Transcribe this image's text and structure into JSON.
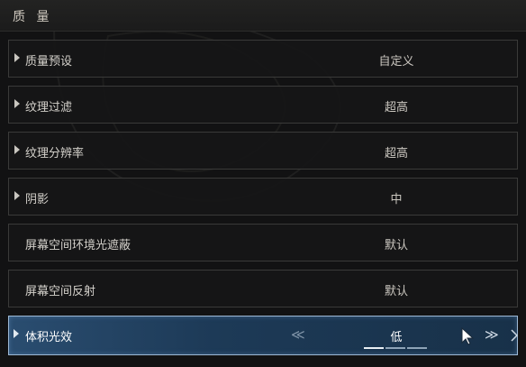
{
  "section": {
    "title": "质 量"
  },
  "rows": [
    {
      "label": "质量预设",
      "value": "自定义",
      "expandable": true
    },
    {
      "label": "纹理过滤",
      "value": "超高",
      "expandable": true
    },
    {
      "label": "纹理分辨率",
      "value": "超高",
      "expandable": true
    },
    {
      "label": "阴影",
      "value": "中",
      "expandable": true
    },
    {
      "label": "屏幕空间环境光遮蔽",
      "value": "默认",
      "expandable": false
    },
    {
      "label": "屏幕空间反射",
      "value": "默认",
      "expandable": false
    },
    {
      "label": "体积光效",
      "value": "低",
      "expandable": true,
      "selected": true
    }
  ],
  "icons": {
    "expand": "caret-right-icon",
    "prev": "chevron-left-icon",
    "next": "chevron-right-icon",
    "cursor": "mouse-cursor-icon"
  },
  "colors": {
    "selected_bg": "#1d3a57",
    "selected_border": "#9db8d4",
    "row_bg": "#161617",
    "row_border": "#3a3a39"
  }
}
